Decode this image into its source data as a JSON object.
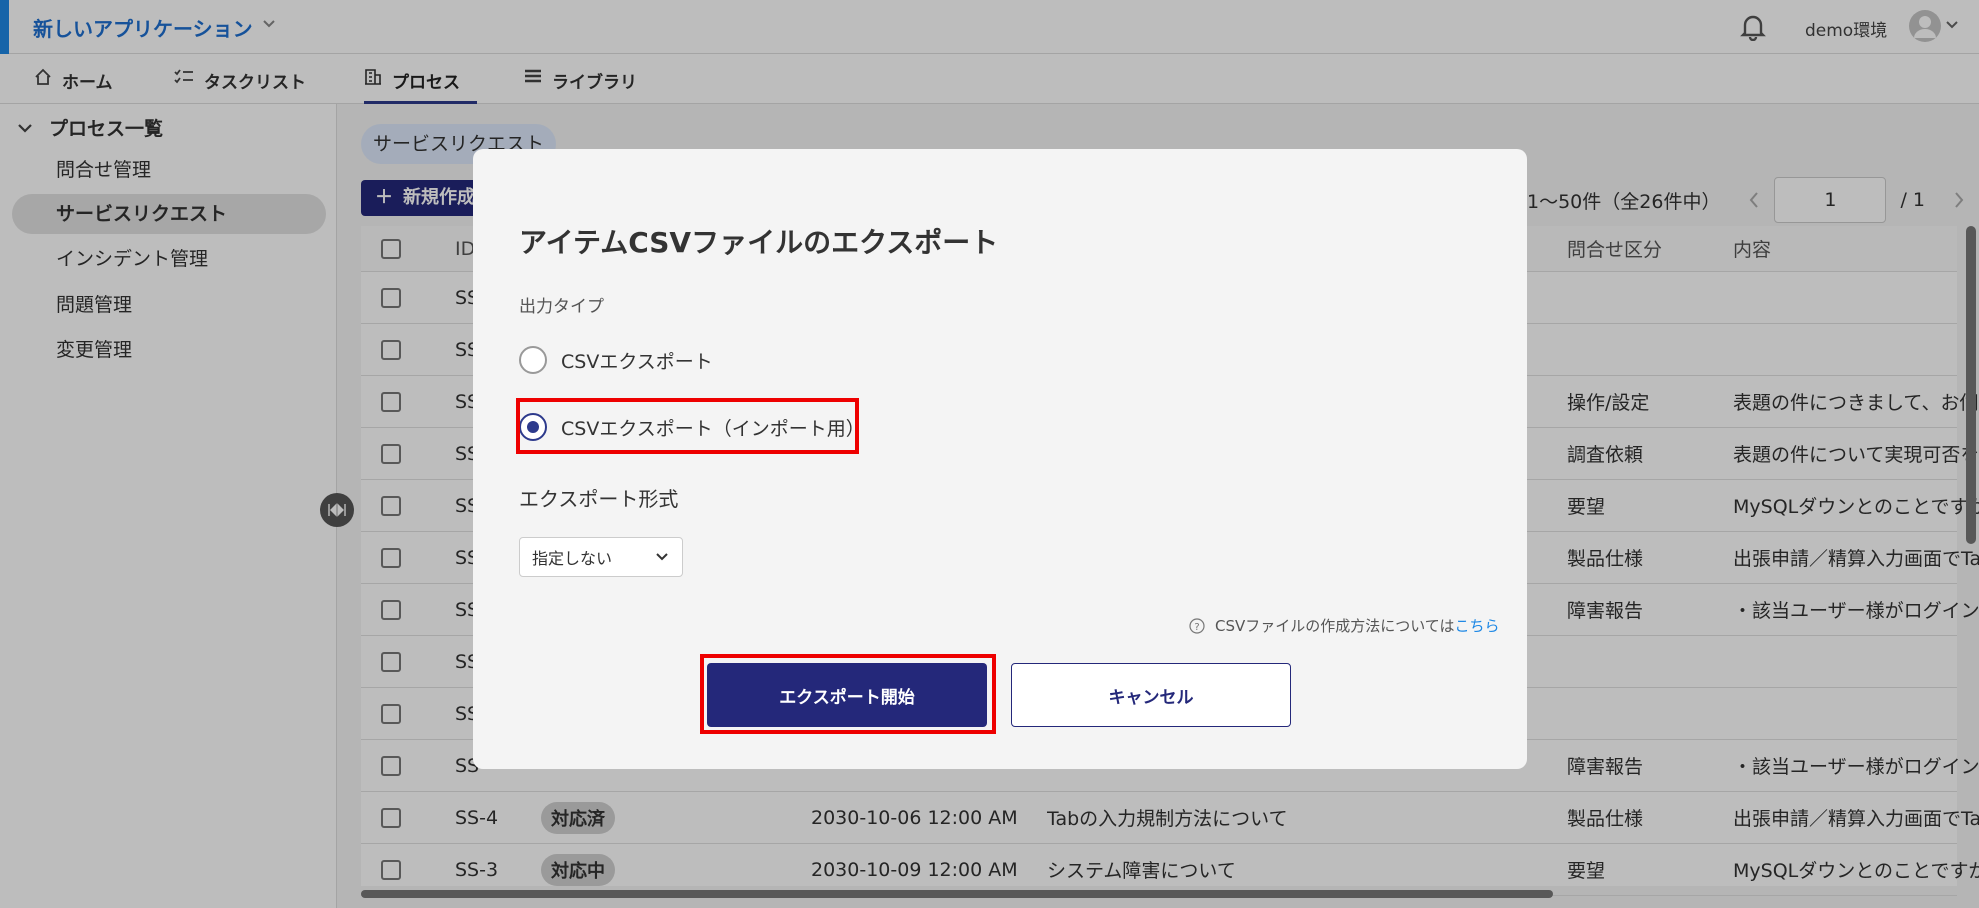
{
  "app": {
    "title": "新しいアプリケーション",
    "env": "demo環境"
  },
  "nav": {
    "tabs": [
      "ホーム",
      "タスクリスト",
      "プロセス",
      "ライブラリ"
    ]
  },
  "sidebar": {
    "header": "プロセス一覧",
    "items": [
      "問合せ管理",
      "サービスリクエスト",
      "インシデント管理",
      "問題管理",
      "変更管理"
    ]
  },
  "main": {
    "chip": "サービスリクエスト",
    "new_button": "新規作成",
    "paging": {
      "range": "1〜50件（全26件中）",
      "page": "1",
      "total": "/ 1"
    }
  },
  "table": {
    "headers": {
      "id": "ID",
      "category": "問合せ区分",
      "content": "内容"
    },
    "rows": [
      {
        "id": "SS",
        "status": "",
        "date": "",
        "title": "",
        "category": "",
        "content": ""
      },
      {
        "id": "SS",
        "status": "",
        "date": "",
        "title": "",
        "category": "",
        "content": ""
      },
      {
        "id": "SS",
        "status": "",
        "date": "",
        "title": "",
        "category": "操作/設定",
        "content": "表題の件につきまして、お伺"
      },
      {
        "id": "SS",
        "status": "",
        "date": "",
        "title": "",
        "category": "調査依頼",
        "content": "表題の件について実現可否を"
      },
      {
        "id": "SS",
        "status": "",
        "date": "",
        "title": "",
        "category": "要望",
        "content": "MySQLダウンとのことですが"
      },
      {
        "id": "SS",
        "status": "",
        "date": "",
        "title": "",
        "category": "製品仕様",
        "content": "出張申請／精算入力画面でTa"
      },
      {
        "id": "SS",
        "status": "",
        "date": "",
        "title": "",
        "category": "障害報告",
        "content": "・該当ユーザー様がログイン"
      },
      {
        "id": "SS",
        "status": "",
        "date": "",
        "title": "",
        "category": "",
        "content": ""
      },
      {
        "id": "SS",
        "status": "",
        "date": "",
        "title": "",
        "category": "",
        "content": ""
      },
      {
        "id": "SS",
        "status": "",
        "date": "",
        "title": "",
        "category": "障害報告",
        "content": "・該当ユーザー様がログイン"
      },
      {
        "id": "SS-4",
        "status": "対応済",
        "date": "2030-10-06 12:00 AM",
        "title": "Tabの入力規制方法について",
        "category": "製品仕様",
        "content": "出張申請／精算入力画面でTa"
      },
      {
        "id": "SS-3",
        "status": "対応中",
        "date": "2030-10-09 12:00 AM",
        "title": "システム障害について",
        "category": "要望",
        "content": "MySQLダウンとのことですが"
      }
    ]
  },
  "modal": {
    "title": "アイテムCSVファイルのエクスポート",
    "output_type_label": "出力タイプ",
    "options": [
      "CSVエクスポート",
      "CSVエクスポート（インポート用）"
    ],
    "selected_option": 1,
    "format_label": "エクスポート形式",
    "format_value": "指定しない",
    "help_text": "CSVファイルの作成方法については",
    "help_link": "こちら",
    "primary_button": "エクスポート開始",
    "cancel_button": "キャンセル"
  },
  "colors": {
    "primary": "#24287a",
    "accent": "#1e88e5",
    "highlight": "#e00000"
  }
}
